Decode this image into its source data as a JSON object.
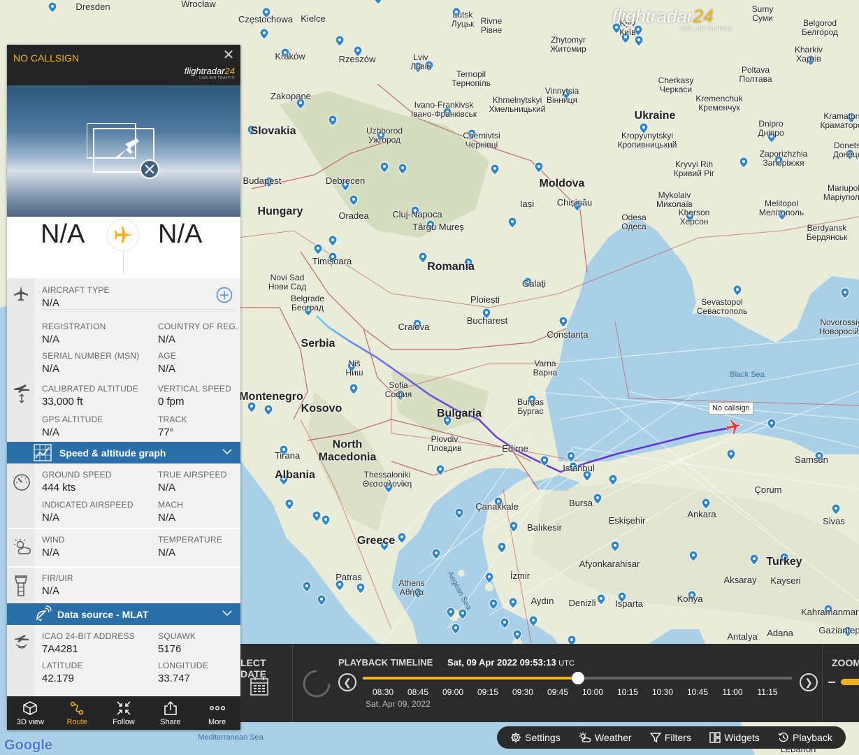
{
  "map": {
    "countries": [
      {
        "key": "slovakia",
        "text": "Slovakia"
      },
      {
        "key": "hungary",
        "text": "Hungary"
      },
      {
        "key": "romania",
        "text": "Romania"
      },
      {
        "key": "serbia",
        "text": "Serbia"
      },
      {
        "key": "bulgaria",
        "text": "Bulgaria"
      },
      {
        "key": "ukraine",
        "text": "Ukraine"
      },
      {
        "key": "moldova",
        "text": "Moldova"
      },
      {
        "key": "greece",
        "text": "Greece"
      },
      {
        "key": "turkey",
        "text": "Turkey"
      },
      {
        "key": "north_macedonia",
        "text": "North\nMacedonia"
      },
      {
        "key": "albania",
        "text": "Albania"
      },
      {
        "key": "kosovo",
        "text": "Kosovo"
      },
      {
        "key": "montenegro",
        "text": "Montenegro"
      }
    ],
    "cities": [
      "Dresden",
      "Wrocław",
      "Częstochowa",
      "Kielce",
      "Lutsk\nЛуцьк",
      "Rivne\nРівне",
      "Zhytomyr\nЖитомир",
      "Kyiv\nКиїв",
      "Sumy\nСуми",
      "Belgorod\nБелгород",
      "Kraków",
      "Rzeszów",
      "Lviv\nЛьвів",
      "Ternopil\nТернопіль",
      "Kharkiv\nХарків",
      "Poltava\nПолтава",
      "Zakopane",
      "Ivano-Frankivsk\nІвано-Франківськ",
      "Khmelnytskyi\nХмельницький",
      "Vinnytsia\nВінниця",
      "Cherkasy\nЧеркаси",
      "Kremenchuk\nКременчук",
      "Uzhhorod\nУжгород",
      "Chernivtsi\nЧернівці",
      "Kropyvnytskyi\nКропивницький",
      "Dnipro\nДніпро",
      "Kramatorsk\nКраматорськ",
      "Budapest",
      "Debrecen",
      "Kryvyi Rih\nКривий Ріг",
      "Zaporizhzhia\nЗапоріжжя",
      "Donetsk\nДонецьк",
      "Iași",
      "Chișinău",
      "Oradea",
      "Cluj-Napoca",
      "Târgu Mureș",
      "Mykolaiv\nМиколаїв",
      "Kherson\nХерсон",
      "Mariupol\nМаріуполь",
      "Odesa\nОдеса",
      "Melitopol\nМелітополь",
      "Berdyansk\nБердянськ",
      "Timișoara",
      "Novi Sad\nНови Сад",
      "Belgrade\nБеоград",
      "Galați",
      "Ploiești",
      "Bucharest",
      "Craiova",
      "Constanța",
      "Sevastopol\nСевастополь",
      "Novorossiysk\nНоворосійськ",
      "Niš\nНиш",
      "Sofia\nСофия",
      "Varna\nВарна",
      "Burgas\nБургас",
      "Plovdiv\nПловдив",
      "Edirne",
      "Istanbul",
      "Tirana",
      "Thessaloniki\nΘεσσαλονίκη",
      "Samsun",
      "Bursa",
      "Çanakkale",
      "Balıkesir",
      "Eskişehir",
      "Ankara",
      "Çorum",
      "Sivas",
      "Afyonkarahisar",
      "İzmir",
      "Aksaray",
      "Kayseri",
      "Patras",
      "Athens\nΑθήνα",
      "Aydın",
      "Denizli",
      "Isparta",
      "Konya",
      "Kahramanmaraş",
      "Antalya",
      "Adana",
      "Gaziantep",
      "Lebanon"
    ],
    "seas": [
      "Black Sea",
      "Aegean Sea",
      "Mediterranean Sea"
    ],
    "aircraft_label": "No callsign"
  },
  "brand": {
    "main": "flightradar",
    "num": "24",
    "sub": "LIVE AIR TRAFFIC"
  },
  "panel": {
    "callsign": "NO CALLSIGN",
    "logo_main": "flightradar",
    "logo_num": "24",
    "logo_sub": "LIVE AIR TRAFFIC",
    "origin": "N/A",
    "destination": "N/A",
    "aircraft_type": {
      "label": "AIRCRAFT TYPE",
      "value": "N/A"
    },
    "registration": {
      "label": "REGISTRATION",
      "value": "N/A"
    },
    "country": {
      "label": "COUNTRY OF REG.",
      "value": "N/A"
    },
    "msn": {
      "label": "SERIAL NUMBER (MSN)",
      "value": "N/A"
    },
    "age": {
      "label": "AGE",
      "value": "N/A"
    },
    "cal_alt": {
      "label": "CALIBRATED ALTITUDE",
      "value": "33,000 ft"
    },
    "vspeed": {
      "label": "VERTICAL SPEED",
      "value": "0 fpm"
    },
    "gps_alt": {
      "label": "GPS ALTITUDE",
      "value": "N/A"
    },
    "track": {
      "label": "TRACK",
      "value": "77°"
    },
    "speed_graph": "Speed & altitude graph",
    "gspeed": {
      "label": "GROUND SPEED",
      "value": "444 kts"
    },
    "tas": {
      "label": "TRUE AIRSPEED",
      "value": "N/A"
    },
    "ias": {
      "label": "INDICATED AIRSPEED",
      "value": "N/A"
    },
    "mach": {
      "label": "MACH",
      "value": "N/A"
    },
    "wind": {
      "label": "WIND",
      "value": "N/A"
    },
    "temp": {
      "label": "TEMPERATURE",
      "value": "N/A"
    },
    "fir": {
      "label": "FIR/UIR",
      "value": "N/A"
    },
    "data_source": "Data source - MLAT",
    "icao": {
      "label": "ICAO 24-BIT ADDRESS",
      "value": "7A4281"
    },
    "squawk": {
      "label": "SQUAWK",
      "value": "5176"
    },
    "lat": {
      "label": "LATITUDE",
      "value": "42.179"
    },
    "lon": {
      "label": "LONGITUDE",
      "value": "33.747"
    },
    "toolbar": [
      "3D view",
      "Route",
      "Follow",
      "Share",
      "More"
    ]
  },
  "playback": {
    "select_date": "LECT DATE",
    "title": "PLAYBACK TIMELINE",
    "time": "Sat, 09 Apr 2022 09:53:13",
    "tz": "UTC",
    "ticks": [
      "08:30",
      "08:45",
      "09:00",
      "09:15",
      "09:30",
      "09:45",
      "10:00",
      "10:15",
      "10:30",
      "10:45",
      "11:00",
      "11:15"
    ],
    "date": "Sat, Apr 09, 2022",
    "progress": 0.502,
    "zoom": "ZOOM"
  },
  "bottom": [
    "Settings",
    "Weather",
    "Filters",
    "Widgets",
    "Playback"
  ],
  "google": "Google",
  "colors": {
    "accent": "#f1b324",
    "panel_dark": "#252525",
    "bluebar": "#2a6fa8",
    "track_start": "#4fd6ff",
    "track_end": "#5a2fd8"
  }
}
